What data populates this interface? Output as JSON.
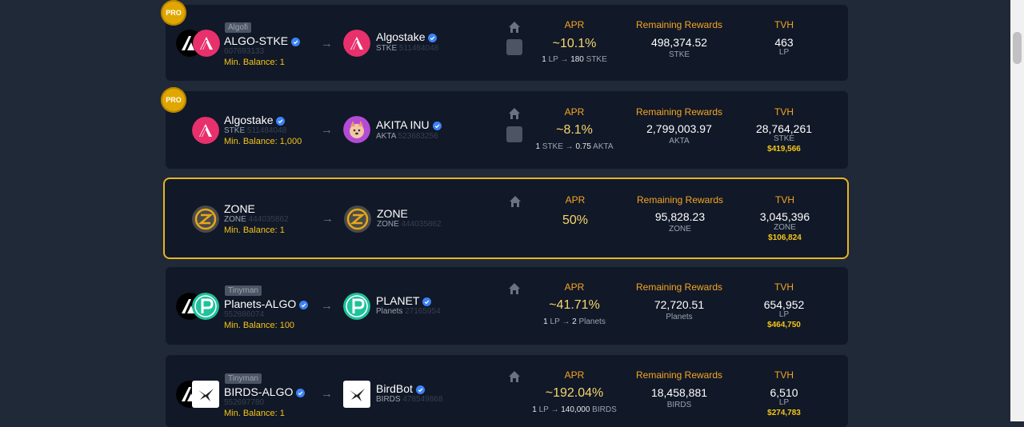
{
  "pools": [
    {
      "pro": "PRO",
      "platform": "Algofi",
      "stake_name": "ALGO-STKE",
      "stake_id": "607693133",
      "min_balance": "Min. Balance: 1",
      "reward_name": "Algostake",
      "reward_ticker": "STKE",
      "reward_id": "511484048",
      "apr_label": "APR",
      "apr": "~10.1%",
      "rate_left": "1",
      "rate_left_unit": "LP",
      "rate_right": "180",
      "rate_right_unit": "STKE",
      "rewards_label": "Remaining Rewards",
      "rewards": "498,374.52",
      "rewards_unit": "STKE",
      "tvh_label": "TVH",
      "tvh": "463",
      "tvh_unit": "LP",
      "tvh_usd": ""
    },
    {
      "pro": "PRO",
      "platform": "",
      "stake_name": "Algostake",
      "stake_ticker": "STKE",
      "stake_id": "511484048",
      "min_balance": "Min. Balance: 1,000",
      "reward_name": "AKITA INU",
      "reward_ticker": "AKTA",
      "reward_id": "523683256",
      "apr_label": "APR",
      "apr": "~8.1%",
      "rate_left": "1",
      "rate_left_unit": "STKE",
      "rate_right": "0.75",
      "rate_right_unit": "AKTA",
      "rewards_label": "Remaining Rewards",
      "rewards": "2,799,003.97",
      "rewards_unit": "AKTA",
      "tvh_label": "TVH",
      "tvh": "28,764,261",
      "tvh_unit": "STKE",
      "tvh_usd": "$419,566"
    },
    {
      "pro": "",
      "platform": "",
      "stake_name": "ZONE",
      "stake_ticker": "ZONE",
      "stake_id": "444035862",
      "min_balance": "Min. Balance: 1",
      "reward_name": "ZONE",
      "reward_ticker": "ZONE",
      "reward_id": "444035862",
      "apr_label": "APR",
      "apr": "50%",
      "rewards_label": "Remaining Rewards",
      "rewards": "95,828.23",
      "rewards_unit": "ZONE",
      "tvh_label": "TVH",
      "tvh": "3,045,396",
      "tvh_unit": "ZONE",
      "tvh_usd": "$106,824"
    },
    {
      "pro": "",
      "platform": "Tinyman",
      "stake_name": "Planets-ALGO",
      "stake_id": "552886074",
      "min_balance": "Min. Balance: 100",
      "reward_name": "PLANET",
      "reward_ticker": "Planets",
      "reward_id": "27165954",
      "apr_label": "APR",
      "apr": "~41.71%",
      "rate_left": "1",
      "rate_left_unit": "LP",
      "rate_right": "2",
      "rate_right_unit": "Planets",
      "rewards_label": "Remaining Rewards",
      "rewards": "72,720.51",
      "rewards_unit": "Planets",
      "tvh_label": "TVH",
      "tvh": "654,952",
      "tvh_unit": "LP",
      "tvh_usd": "$464,750"
    },
    {
      "pro": "",
      "platform": "Tinyman",
      "stake_name": "BIRDS-ALGO",
      "stake_id": "552697780",
      "min_balance": "Min. Balance: 1",
      "reward_name": "BirdBot",
      "reward_ticker": "BIRDS",
      "reward_id": "478549868",
      "apr_label": "APR",
      "apr": "~192.04%",
      "rate_left": "1",
      "rate_left_unit": "LP",
      "rate_right": "140,000",
      "rate_right_unit": "BIRDS",
      "rewards_label": "Remaining Rewards",
      "rewards": "18,458,881",
      "rewards_unit": "BIRDS",
      "tvh_label": "TVH",
      "tvh": "6,510",
      "tvh_unit": "LP",
      "tvh_usd": "$274,783"
    }
  ],
  "colors": {
    "background": "#202937",
    "card": "#111827",
    "accent": "#f5a623",
    "highlight_border": "#e7b520"
  }
}
